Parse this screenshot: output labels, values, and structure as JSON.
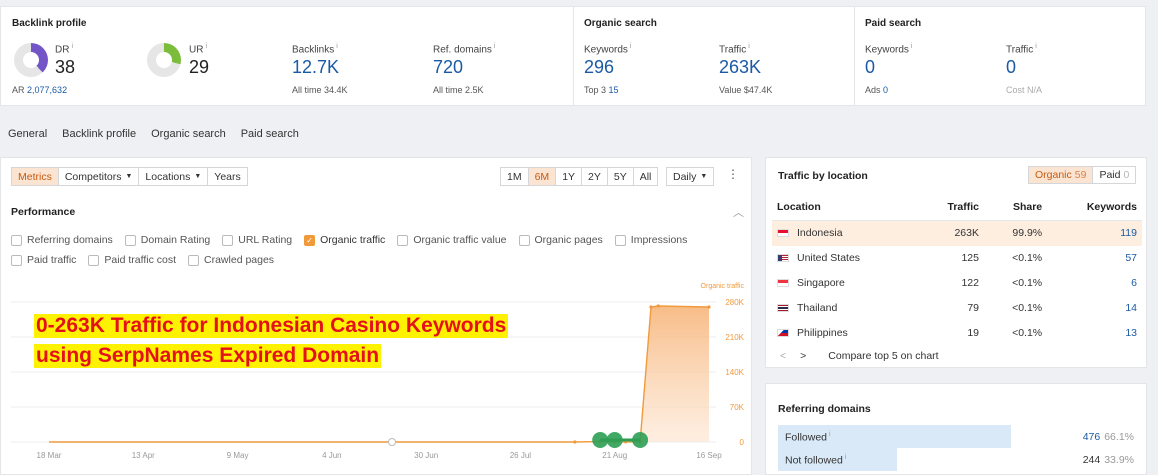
{
  "stats": {
    "backlink_profile": {
      "title": "Backlink profile",
      "dr": {
        "label": "DR",
        "value": "38",
        "info": "i"
      },
      "ar": {
        "label": "AR",
        "value": "2,077,632"
      },
      "ur": {
        "label": "UR",
        "value": "29",
        "info": "i"
      },
      "backlinks": {
        "label": "Backlinks",
        "value": "12.7K",
        "sub": "All time 34.4K",
        "info": "i"
      },
      "ref_domains": {
        "label": "Ref. domains",
        "value": "720",
        "sub": "All time 2.5K",
        "info": "i"
      }
    },
    "organic_search": {
      "title": "Organic search",
      "keywords": {
        "label": "Keywords",
        "value": "296",
        "sub_label": "Top 3",
        "sub_value": "15",
        "info": "i"
      },
      "traffic": {
        "label": "Traffic",
        "value": "263K",
        "sub": "Value $47.4K",
        "info": "i"
      }
    },
    "paid_search": {
      "title": "Paid search",
      "keywords": {
        "label": "Keywords",
        "value": "0",
        "sub_label": "Ads",
        "sub_value": "0",
        "info": "i"
      },
      "traffic": {
        "label": "Traffic",
        "value": "0",
        "sub": "Cost N/A",
        "info": "i"
      }
    }
  },
  "tabs": [
    "General",
    "Backlink profile",
    "Organic search",
    "Paid search"
  ],
  "toolbar": {
    "metrics": "Metrics",
    "competitors": "Competitors",
    "locations": "Locations",
    "years": "Years",
    "ranges": [
      "1M",
      "6M",
      "1Y",
      "2Y",
      "5Y",
      "All"
    ],
    "active_range": "6M",
    "interval": "Daily",
    "more": "⋮"
  },
  "performance": {
    "title": "Performance",
    "collapse": "︿",
    "checkboxes": [
      {
        "label": "Referring domains",
        "checked": false
      },
      {
        "label": "Domain Rating",
        "checked": false
      },
      {
        "label": "URL Rating",
        "checked": false
      },
      {
        "label": "Organic traffic",
        "checked": true
      },
      {
        "label": "Organic traffic value",
        "checked": false
      },
      {
        "label": "Organic pages",
        "checked": false
      },
      {
        "label": "Impressions",
        "checked": false
      },
      {
        "label": "Paid traffic",
        "checked": false
      },
      {
        "label": "Paid traffic cost",
        "checked": false
      },
      {
        "label": "Crawled pages",
        "checked": false
      }
    ],
    "overlay_line1": "0-263K Traffic for Indonesian Casino Keywords",
    "overlay_line2": "using SerpNames Expired Domain"
  },
  "chart_data": {
    "type": "area",
    "series": [
      {
        "name": "Organic traffic",
        "color": "#f19a3c",
        "x": [
          "18 Mar",
          "13 Apr",
          "9 May",
          "4 Jun",
          "30 Jun",
          "26 Jul",
          "10 Aug",
          "17 Aug",
          "21 Aug",
          "24 Aug",
          "28 Aug",
          "31 Aug",
          "2 Sep",
          "16 Sep"
        ],
        "values": [
          0,
          0,
          0,
          0,
          0,
          0,
          0,
          800,
          0,
          200,
          0,
          270000,
          272000,
          270000
        ]
      }
    ],
    "x_tick_labels": [
      "18 Mar",
      "13 Apr",
      "9 May",
      "4 Jun",
      "30 Jun",
      "26 Jul",
      "21 Aug",
      "16 Sep"
    ],
    "y_tick_labels": [
      "0",
      "70K",
      "140K",
      "210K",
      "280K"
    ],
    "ylim": [
      0,
      280000
    ],
    "y_axis_title": "Organic traffic",
    "grid": true
  },
  "traffic_by_location": {
    "title": "Traffic by location",
    "organic_label": "Organic",
    "organic_count": "59",
    "paid_label": "Paid",
    "paid_count": "0",
    "columns": [
      "Location",
      "Traffic",
      "Share",
      "Keywords"
    ],
    "rows": [
      {
        "country": "Indonesia",
        "flag": "indonesia-flag",
        "traffic": "263K",
        "share": "99.9%",
        "keywords": "119"
      },
      {
        "country": "United States",
        "flag": "us-flag",
        "traffic": "125",
        "share": "<0.1%",
        "keywords": "57"
      },
      {
        "country": "Singapore",
        "flag": "singapore-flag",
        "traffic": "122",
        "share": "<0.1%",
        "keywords": "6"
      },
      {
        "country": "Thailand",
        "flag": "thailand-flag",
        "traffic": "79",
        "share": "<0.1%",
        "keywords": "14"
      },
      {
        "country": "Philippines",
        "flag": "philippines-flag",
        "traffic": "19",
        "share": "<0.1%",
        "keywords": "13"
      }
    ],
    "prev": "<",
    "next": ">",
    "compare_label": "Compare top 5 on chart"
  },
  "referring_domains": {
    "title": "Referring domains",
    "rows": [
      {
        "label": "Followed",
        "count": "476",
        "pct": "66.1%",
        "fraction": 0.661
      },
      {
        "label": "Not followed",
        "count": "244",
        "pct": "33.9%",
        "fraction": 0.339
      }
    ]
  }
}
